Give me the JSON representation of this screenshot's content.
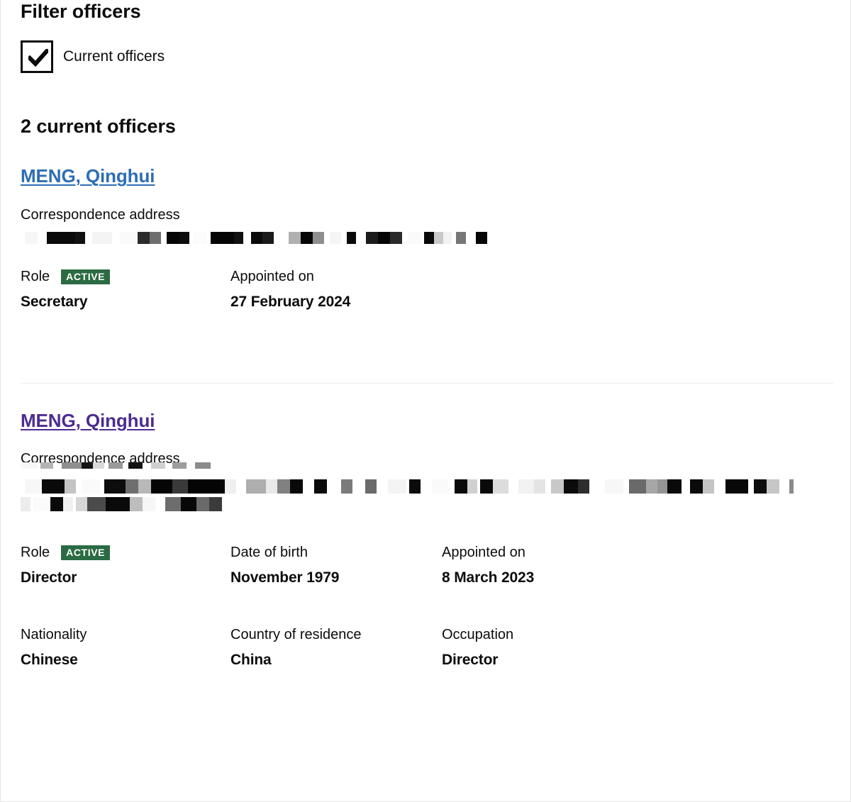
{
  "filter": {
    "heading": "Filter officers",
    "checkbox": {
      "label": "Current officers",
      "checked": true,
      "icon": "checkmark-icon"
    }
  },
  "results": {
    "count_heading": "2 current officers"
  },
  "colors": {
    "link": "#2d6db5",
    "link_visited": "#4c2c92",
    "badge_active": "#2b6b43",
    "text": "#0b0c0c",
    "divider": "#ececec",
    "page_border": "#e6e6e6"
  },
  "officers": [
    {
      "name": "MENG, Qinghui",
      "link_state": "unvisited",
      "address_label": "Correspondence address",
      "address_value": "",
      "address_redacted": true,
      "fields": [
        {
          "label": "Role",
          "value": "Secretary",
          "badge": "ACTIVE"
        },
        {
          "label": "Appointed on",
          "value": "27 February 2024"
        }
      ]
    },
    {
      "name": "MENG, Qinghui",
      "link_state": "visited",
      "address_label": "Correspondence address",
      "address_value": "",
      "address_redacted": true,
      "fields": [
        {
          "label": "Role",
          "value": "Director",
          "badge": "ACTIVE"
        },
        {
          "label": "Date of birth",
          "value": "November 1979"
        },
        {
          "label": "Appointed on",
          "value": "8 March 2023"
        },
        {
          "label": "Nationality",
          "value": "Chinese"
        },
        {
          "label": "Country of residence",
          "value": "China"
        },
        {
          "label": "Occupation",
          "value": "Director"
        }
      ]
    }
  ]
}
